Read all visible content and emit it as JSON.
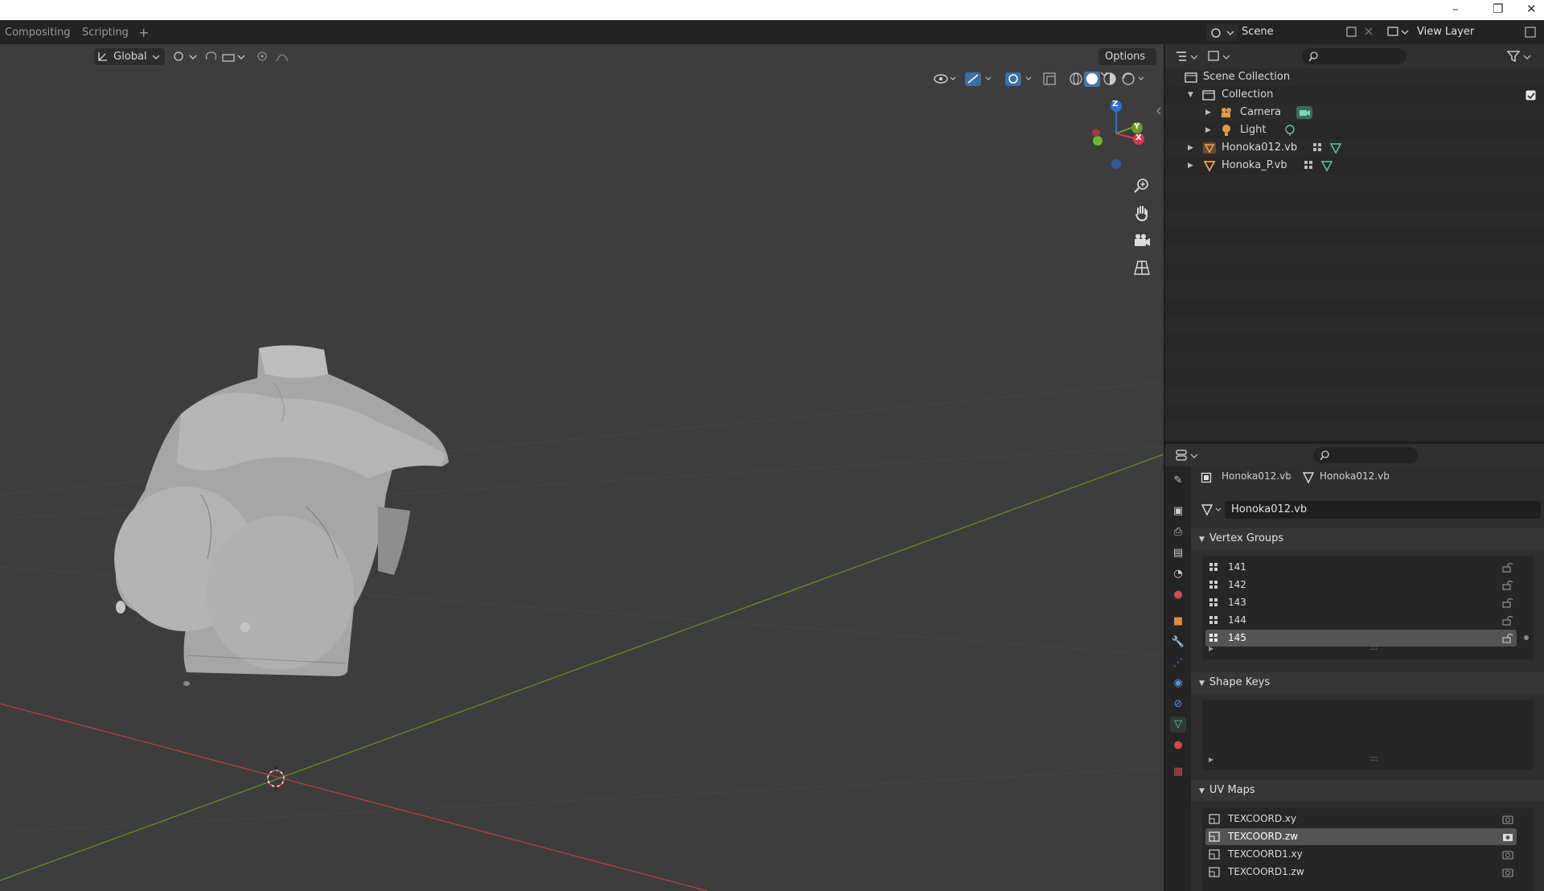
{
  "window": {
    "minimize": "–",
    "restore": "❐",
    "close": "✕"
  },
  "topbar": {
    "workspaces": [
      {
        "label": "Compositing"
      },
      {
        "label": "Scripting"
      }
    ],
    "add_workspace": "+",
    "scene_name": "Scene",
    "view_layer": "View Layer"
  },
  "viewport": {
    "orientation": "Global",
    "options_label": "Options",
    "gizmo_axes": {
      "z": "Z",
      "y": "Y",
      "x": "X"
    },
    "nav_icons": [
      "zoom-icon",
      "hand-pan-icon",
      "camera-view-icon",
      "grid-ortho-icon"
    ],
    "colors": {
      "background": "#3d3d3d",
      "x_axis": "#b54141",
      "y_axis": "#6b8e23",
      "mesh": "#a9a9a9"
    }
  },
  "outliner": {
    "rows": [
      {
        "label": "Scene Collection",
        "icon": "scene-collection-icon"
      },
      {
        "label": "Collection",
        "icon": "collection-icon",
        "checked": true
      },
      {
        "label": "Camera",
        "icon": "camera-object-icon",
        "data_icon": "camera-data-icon"
      },
      {
        "label": "Light",
        "icon": "light-object-icon",
        "data_icon": "light-data-icon"
      },
      {
        "label": "Honoka012.vb",
        "icon": "mesh-object-icon",
        "data_icon": "vertex-groups-icon"
      },
      {
        "label": "Honoka_P.vb",
        "icon": "mesh-object-icon",
        "data_icon": "vertex-groups-icon"
      }
    ]
  },
  "properties": {
    "breadcrumb": {
      "object": "Honoka012.vb",
      "mesh": "Honoka012.vb"
    },
    "mesh_name": "Honoka012.vb",
    "vertex_groups": {
      "title": "Vertex Groups",
      "items": [
        "141",
        "142",
        "143",
        "144",
        "145"
      ],
      "selected_index": 4
    },
    "shape_keys": {
      "title": "Shape Keys",
      "items": []
    },
    "uv_maps": {
      "title": "UV Maps",
      "items": [
        "TEXCOORD.xy",
        "TEXCOORD.zw",
        "TEXCOORD1.xy",
        "TEXCOORD1.zw"
      ],
      "selected_index": 1
    },
    "tab_icons": [
      "tool-icon",
      "render-icon",
      "output-icon",
      "view-layer-icon",
      "scene-icon",
      "world-icon",
      "object-icon",
      "modifier-icon",
      "particles-icon",
      "physics-icon",
      "constraints-icon",
      "mesh-data-icon",
      "material-icon",
      "texture-icon"
    ]
  }
}
